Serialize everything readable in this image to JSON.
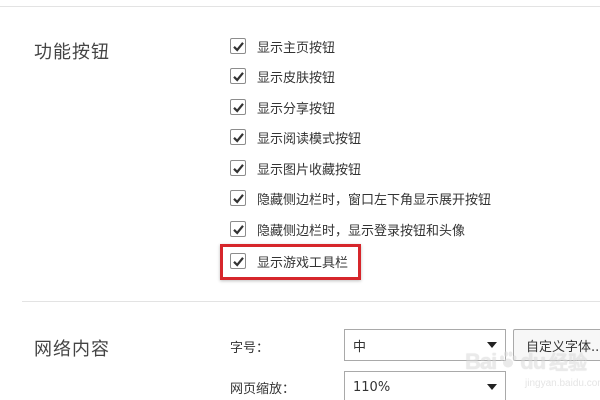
{
  "sections": {
    "function_buttons": {
      "title": "功能按钮",
      "options": [
        {
          "label": "显示主页按钮",
          "checked": true
        },
        {
          "label": "显示皮肤按钮",
          "checked": true
        },
        {
          "label": "显示分享按钮",
          "checked": true
        },
        {
          "label": "显示阅读模式按钮",
          "checked": true
        },
        {
          "label": "显示图片收藏按钮",
          "checked": true
        },
        {
          "label": "隐藏侧边栏时，窗口左下角显示展开按钮",
          "checked": true
        },
        {
          "label": "隐藏侧边栏时，显示登录按钮和头像",
          "checked": true
        },
        {
          "label": "显示游戏工具栏",
          "checked": true,
          "highlighted": true
        }
      ]
    },
    "web_content": {
      "title": "网络内容",
      "font_size": {
        "label": "字号：",
        "value": "中"
      },
      "custom_font_button": "自定义字体...",
      "page_zoom": {
        "label": "网页缩放：",
        "value": "110%"
      }
    }
  },
  "watermark": {
    "text_left": "Bai",
    "text_right": "du",
    "text_cn": "经验",
    "sub": "jingyan.baidu.com"
  },
  "colors": {
    "highlight": "#d6262b",
    "check": "#333333",
    "divider": "#e3e3e3"
  }
}
